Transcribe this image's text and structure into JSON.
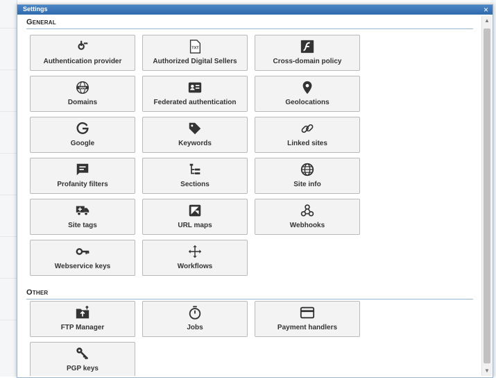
{
  "dialog": {
    "title": "Settings",
    "close_glyph": "×"
  },
  "sections": {
    "general": {
      "heading": "General",
      "items": [
        {
          "label": "Authentication provider",
          "icon": "key-turn-icon"
        },
        {
          "label": "Authorized Digital Sellers",
          "icon": "txt-file-icon"
        },
        {
          "label": "Cross-domain policy",
          "icon": "flash-icon"
        },
        {
          "label": "Domains",
          "icon": "www-globe-icon"
        },
        {
          "label": "Federated authentication",
          "icon": "id-card-icon"
        },
        {
          "label": "Geolocations",
          "icon": "map-pin-icon"
        },
        {
          "label": "Google",
          "icon": "google-g-icon"
        },
        {
          "label": "Keywords",
          "icon": "tag-icon"
        },
        {
          "label": "Linked sites",
          "icon": "link-icon"
        },
        {
          "label": "Profanity filters",
          "icon": "comment-icon"
        },
        {
          "label": "Sections",
          "icon": "tree-icon"
        },
        {
          "label": "Site info",
          "icon": "globe-icon"
        },
        {
          "label": "Site tags",
          "icon": "truck-icon"
        },
        {
          "label": "URL maps",
          "icon": "map-icon"
        },
        {
          "label": "Webhooks",
          "icon": "webhook-icon"
        },
        {
          "label": "Webservice keys",
          "icon": "vpn-key-icon"
        },
        {
          "label": "Workflows",
          "icon": "move-arrows-icon"
        }
      ]
    },
    "other": {
      "heading": "Other",
      "items": [
        {
          "label": "FTP Manager",
          "icon": "folder-upload-icon"
        },
        {
          "label": "Jobs",
          "icon": "timer-icon"
        },
        {
          "label": "Payment handlers",
          "icon": "credit-card-icon"
        },
        {
          "label": "PGP keys",
          "icon": "key-icon"
        }
      ]
    }
  },
  "scrollbar": {
    "up": "▲",
    "down": "▼"
  }
}
